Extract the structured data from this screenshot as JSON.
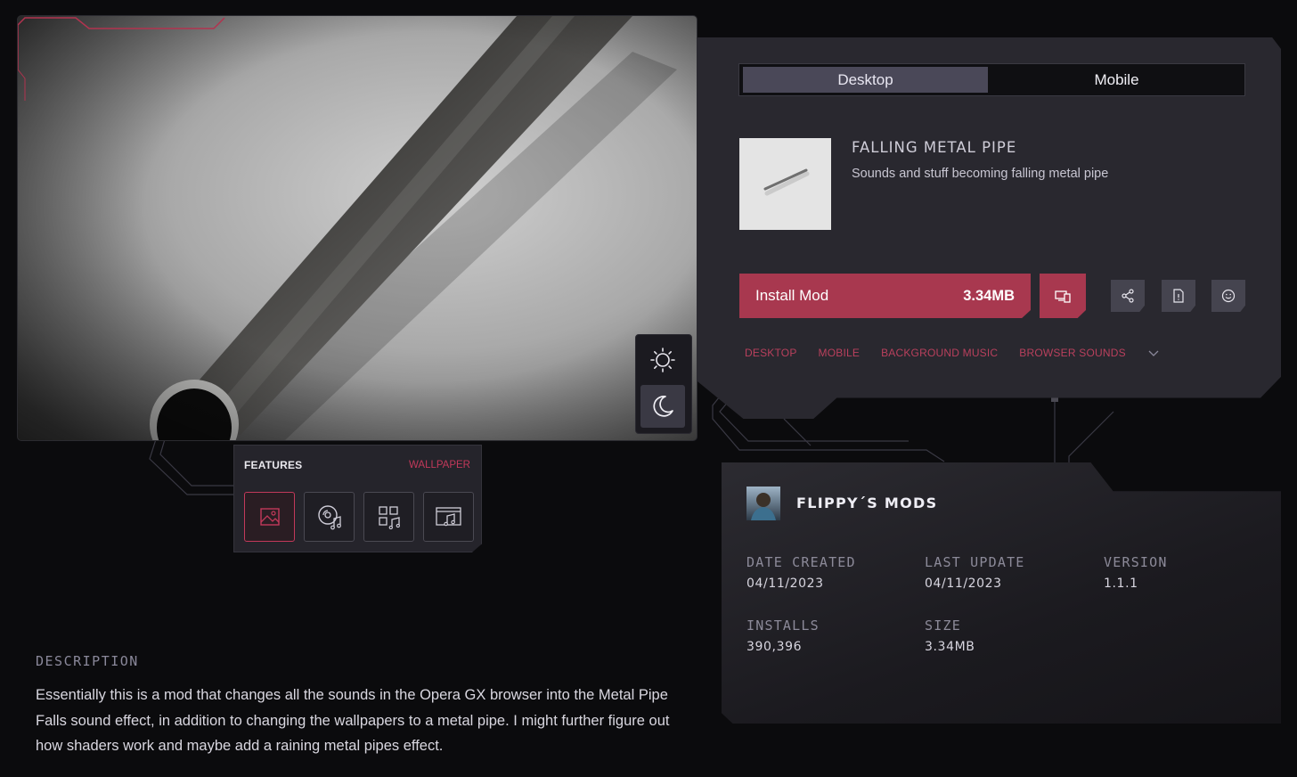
{
  "features": {
    "title": "FEATURES",
    "active_tag": "WALLPAPER",
    "icons": [
      "wallpaper-icon",
      "music-disc-icon",
      "apps-music-icon",
      "browser-sound-icon"
    ]
  },
  "description": {
    "heading": "DESCRIPTION",
    "text": "Essentially this is a mod that changes all the sounds in the Opera GX browser into the Metal Pipe Falls sound effect, in addition to changing the wallpapers to a metal pipe. I might further figure out how shaders work and maybe add a raining metal pipes effect."
  },
  "platform_tabs": [
    "Desktop",
    "Mobile"
  ],
  "mod": {
    "name": "FALLING METAL PIPE",
    "subtitle": "Sounds and stuff becoming falling metal pipe",
    "install_label": "Install Mod",
    "size": "3.34MB"
  },
  "tags": [
    "DESKTOP",
    "MOBILE",
    "BACKGROUND MUSIC",
    "BROWSER SOUNDS"
  ],
  "creator": {
    "name": "FLIPPY´S MODS",
    "stats": [
      {
        "label": "DATE CREATED",
        "value": "04/11/2023"
      },
      {
        "label": "LAST UPDATE",
        "value": "04/11/2023"
      },
      {
        "label": "VERSION",
        "value": "1.1.1"
      },
      {
        "label": "INSTALLS",
        "value": "390,396"
      },
      {
        "label": "SIZE",
        "value": "3.34MB"
      }
    ]
  },
  "colors": {
    "accent": "#a8384f",
    "accent_text": "#c2395a",
    "panel": "#29282f",
    "background": "#0b0b0d"
  }
}
